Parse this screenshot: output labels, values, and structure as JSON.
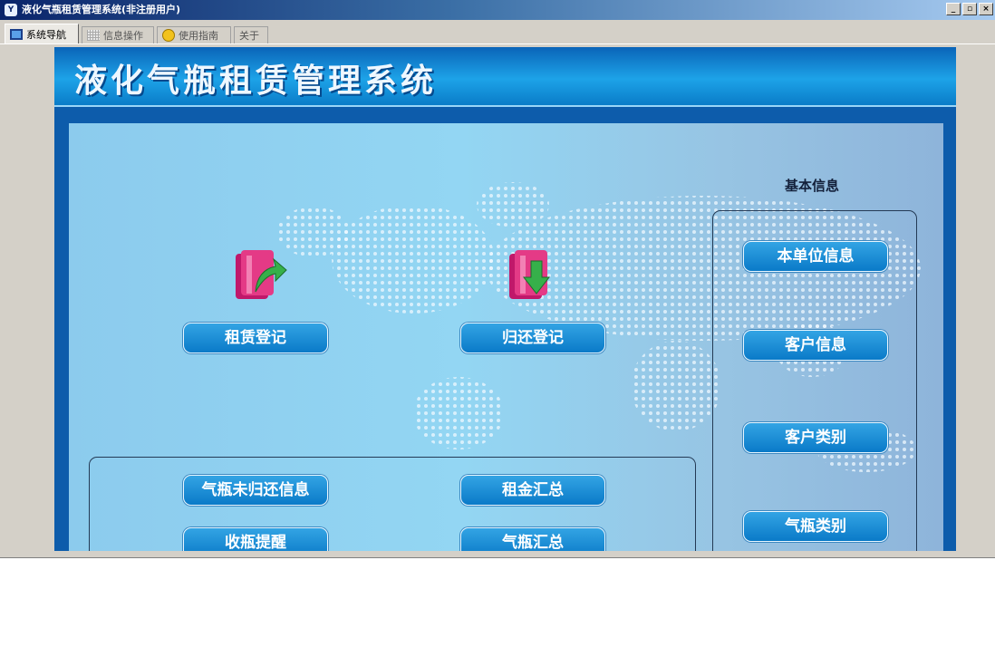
{
  "window": {
    "title": "液化气瓶租赁管理系统(非注册用户)",
    "icon_text": "Y",
    "controls": [
      "_",
      "▫",
      "×"
    ]
  },
  "tabs": [
    {
      "label": "系统导航",
      "icon": "monitor-icon",
      "active": true
    },
    {
      "label": "信息操作",
      "icon": "grid-icon",
      "active": false
    },
    {
      "label": "使用指南",
      "icon": "help-icon",
      "active": false
    },
    {
      "label": "关于",
      "icon": "",
      "active": false
    }
  ],
  "main": {
    "system_title": "液化气瓶租赁管理系统",
    "rent_button": "租赁登记",
    "return_button": "归还登记",
    "reports": {
      "unreturned_button": "气瓶未归还信息",
      "rent_summary_button": "租金汇总",
      "collect_reminder_button": "收瓶提醒",
      "cylinder_summary_button": "气瓶汇总"
    },
    "basic_info": {
      "label": "基本信息",
      "unit_info_button": "本单位信息",
      "customer_info_button": "客户信息",
      "customer_type_button": "客户类别",
      "cylinder_type_button": "气瓶类别"
    }
  },
  "colors": {
    "titlebar_start": "#0a246a",
    "header_blue": "#1da3e8",
    "button_blue": "#0a7ac8",
    "panel_light": "#93d6f3"
  }
}
